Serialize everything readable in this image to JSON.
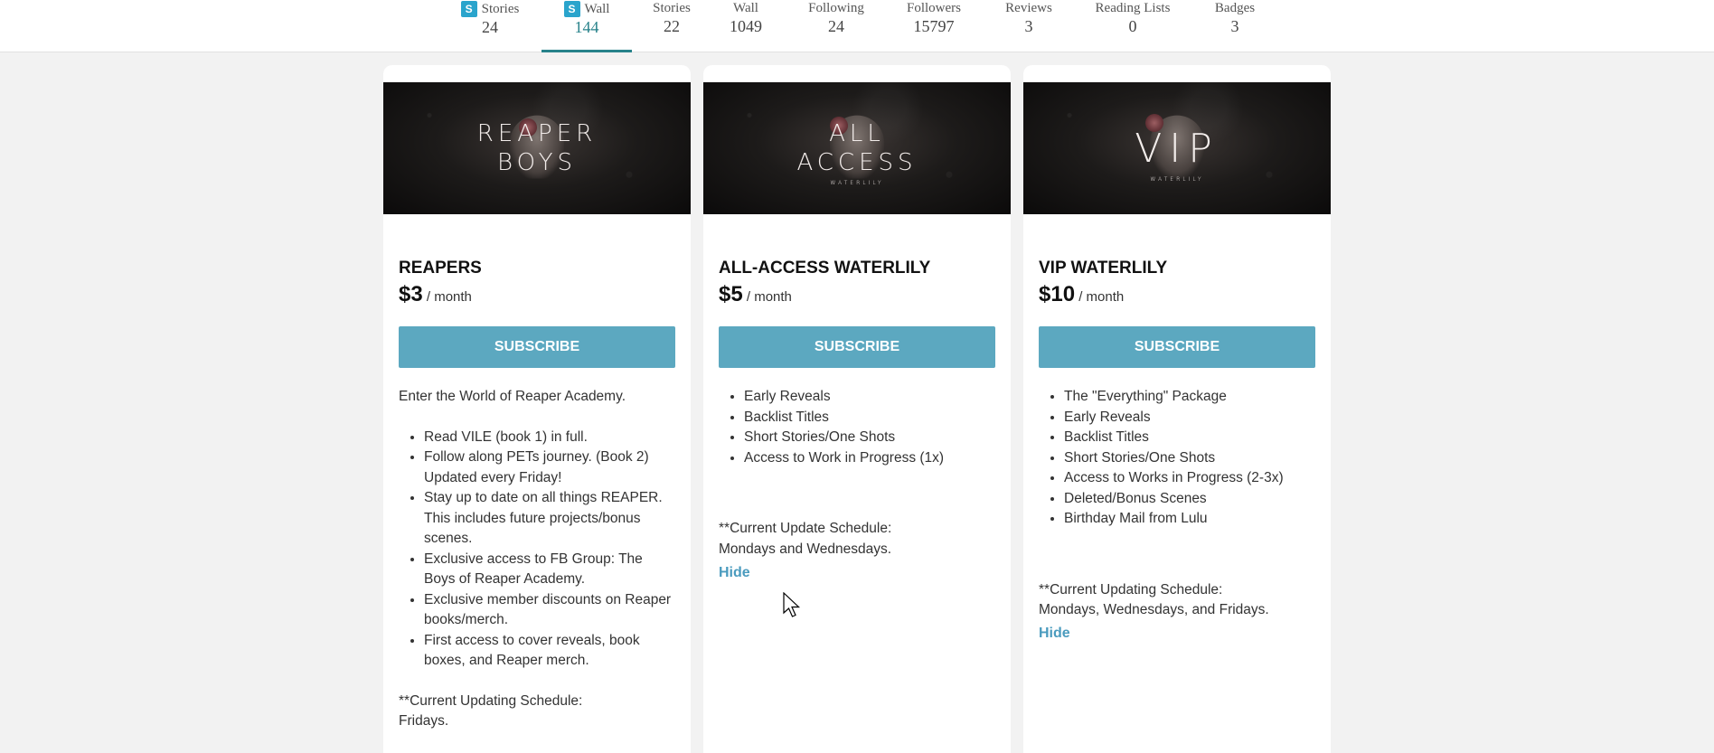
{
  "nav": {
    "tabs": [
      {
        "label": "Stories",
        "count": "24",
        "badge": "S",
        "active": false
      },
      {
        "label": "Wall",
        "count": "144",
        "badge": "S",
        "active": true
      },
      {
        "label": "Stories",
        "count": "22"
      },
      {
        "label": "Wall",
        "count": "1049"
      },
      {
        "label": "Following",
        "count": "24"
      },
      {
        "label": "Followers",
        "count": "15797"
      },
      {
        "label": "Reviews",
        "count": "3"
      },
      {
        "label": "Reading Lists",
        "count": "0"
      },
      {
        "label": "Badges",
        "count": "3"
      }
    ]
  },
  "tiers": [
    {
      "banner_line1": "REAPER",
      "banner_line2": "BOYS",
      "title": "REAPERS",
      "price": "$3",
      "period": "/ month",
      "subscribe_label": "SUBSCRIBE",
      "intro": "Enter the World of Reaper Academy.",
      "perks": [
        "Read VILE (book 1) in full.",
        "Follow along PETs journey. (Book 2) Updated every Friday!",
        "Stay up to date on all things REAPER. This includes future projects/bonus scenes.",
        "Exclusive access to FB Group: The Boys of Reaper Academy.",
        "Exclusive member discounts on Reaper books/merch.",
        "First access to cover reveals, book boxes, and Reaper merch."
      ],
      "schedule_line1": "**Current Updating Schedule:",
      "schedule_line2": "Fridays."
    },
    {
      "banner_line1": "ALL",
      "banner_line2": "ACCESS",
      "banner_small": "WATERLILY",
      "title": "ALL-ACCESS WATERLILY",
      "price": "$5",
      "period": "/ month",
      "subscribe_label": "SUBSCRIBE",
      "perks": [
        "Early Reveals",
        "Backlist Titles",
        "Short Stories/One Shots",
        "Access to Work in Progress (1x)"
      ],
      "schedule_line1": "**Current Update Schedule:",
      "schedule_line2": "Mondays and Wednesdays.",
      "hide_label": "Hide"
    },
    {
      "banner_line1": "VIP",
      "banner_small": "WATERLILY",
      "title": "VIP WATERLILY",
      "price": "$10",
      "period": "/ month",
      "subscribe_label": "SUBSCRIBE",
      "perks": [
        "The \"Everything\" Package",
        "Early Reveals",
        "Backlist Titles",
        "Short Stories/One Shots",
        "Access to Works in Progress (2-3x)",
        "Deleted/Bonus Scenes",
        "Birthday Mail from Lulu"
      ],
      "schedule_line1": "**Current Updating Schedule:",
      "schedule_line2": "Mondays, Wednesdays, and Fridays.",
      "hide_label": "Hide"
    }
  ],
  "colors": {
    "accent": "#27828a",
    "button": "#5ca8c0",
    "link": "#4a9bbe",
    "badge": "#2aa4cc"
  }
}
